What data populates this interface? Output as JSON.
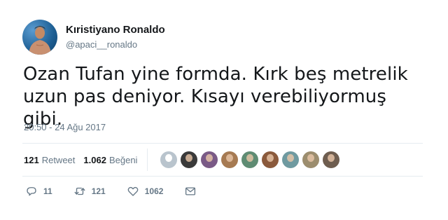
{
  "user": {
    "display_name": "Kıristiyano Ronaldo",
    "handle": "@apaci__ronaldo"
  },
  "tweet": {
    "text_line1": "Ozan Tufan yine formda. Kırk beş metrelik",
    "text_line2": "uzun pas deniyor. Kısayı verebiliyormuş gibi.",
    "timestamp": "20:50 - 24 Ağu 2017"
  },
  "stats": {
    "retweets": "121",
    "retweets_label": "Retweet",
    "likes": "1.062",
    "likes_label": "Beğeni"
  },
  "actions": {
    "reply_count": "11",
    "retweet_count": "121",
    "like_count": "1062"
  },
  "liker_colors": [
    "#b9c4cd",
    "#3a3a3a",
    "#7a5a86",
    "#a67a52",
    "#5f8c73",
    "#8b5a3c",
    "#6f9aa0",
    "#9c8d6e",
    "#6e5d4f"
  ],
  "colors": {
    "text": "#14171a",
    "secondary": "#657786",
    "divider": "#e6ecf0"
  }
}
